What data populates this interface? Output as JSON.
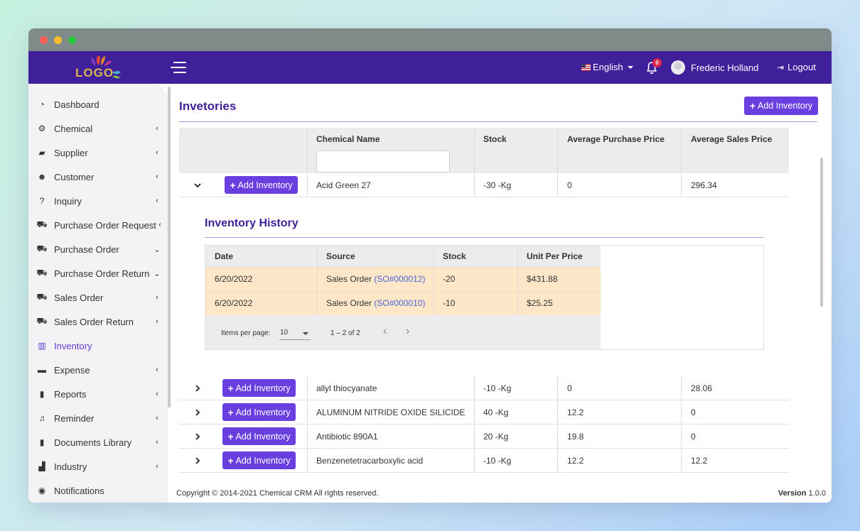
{
  "navbar": {
    "logo_text": "LOGO",
    "language": "English",
    "notifications_count": "0",
    "user_name": "Frederic Holland",
    "logout_label": "Logout"
  },
  "sidebar": {
    "items": [
      {
        "label": "Dashboard",
        "icon": "dashboard-icon",
        "arrow": ""
      },
      {
        "label": "Chemical",
        "icon": "gear-icon",
        "arrow": "‹"
      },
      {
        "label": "Supplier",
        "icon": "truck-icon",
        "arrow": "‹"
      },
      {
        "label": "Customer",
        "icon": "users-icon",
        "arrow": "‹"
      },
      {
        "label": "Inquiry",
        "icon": "question-icon",
        "arrow": "‹"
      },
      {
        "label": "Purchase Order Request",
        "icon": "cart-icon",
        "arrow": "‹"
      },
      {
        "label": "Purchase Order",
        "icon": "cart-icon",
        "arrow": "⌄"
      },
      {
        "label": "Purchase Order Return",
        "icon": "cart-icon",
        "arrow": "⌄"
      },
      {
        "label": "Sales Order",
        "icon": "cart-icon",
        "arrow": "‹"
      },
      {
        "label": "Sales Order Return",
        "icon": "cart-icon",
        "arrow": "‹"
      },
      {
        "label": "Inventory",
        "icon": "inventory-icon",
        "arrow": ""
      },
      {
        "label": "Expense",
        "icon": "wallet-icon",
        "arrow": "‹"
      },
      {
        "label": "Reports",
        "icon": "bar-chart-icon",
        "arrow": "‹"
      },
      {
        "label": "Reminder",
        "icon": "bell-icon",
        "arrow": "‹"
      },
      {
        "label": "Documents Library",
        "icon": "file-icon",
        "arrow": "‹"
      },
      {
        "label": "Industry",
        "icon": "industry-icon",
        "arrow": "‹"
      },
      {
        "label": "Notifications",
        "icon": "stopwatch-icon",
        "arrow": ""
      }
    ]
  },
  "page": {
    "title": "Invetories",
    "add_button_label": "Add Inventory"
  },
  "table": {
    "columns": [
      "Chemical Name",
      "Stock",
      "Average Purchase Price",
      "Average Sales Price"
    ],
    "filter_value": "",
    "row_button_label": "Add Inventory",
    "rows": [
      {
        "name": "Acid Green 27",
        "stock": "-30 -Kg",
        "avg_purchase": "0",
        "avg_sales": "296.34",
        "expanded": true
      },
      {
        "name": "allyl thiocyanate",
        "stock": "-10 -Kg",
        "avg_purchase": "0",
        "avg_sales": "28.06",
        "expanded": false
      },
      {
        "name": "ALUMINUM NITRIDE OXIDE SILICIDE",
        "stock": "40 -Kg",
        "avg_purchase": "12.2",
        "avg_sales": "0",
        "expanded": false
      },
      {
        "name": "Antibiotic 890A1",
        "stock": "20 -Kg",
        "avg_purchase": "19.8",
        "avg_sales": "0",
        "expanded": false
      },
      {
        "name": "Benzenetetracarboxylic acid",
        "stock": "-10 -Kg",
        "avg_purchase": "12.2",
        "avg_sales": "12.2",
        "expanded": false
      }
    ]
  },
  "history": {
    "title": "Inventory History",
    "columns": [
      "Date",
      "Source",
      "Stock",
      "Unit Per Price"
    ],
    "rows": [
      {
        "date": "6/20/2022",
        "source": "Sales Order",
        "source_link": "(SO#000012)",
        "stock": "-20",
        "unit_price": "$431.88"
      },
      {
        "date": "6/20/2022",
        "source": "Sales Order",
        "source_link": "(SO#000010)",
        "stock": "-10",
        "unit_price": "$25.25"
      }
    ],
    "paginator": {
      "items_per_page_label": "Items per page:",
      "items_per_page_value": "10",
      "range_label": "1 – 2 of 2"
    }
  },
  "footer": {
    "copyright": "Copyright © 2014-2021 Chemical CRM All rights reserved.",
    "version_label": "Version",
    "version_value": "1.0.0"
  },
  "colors": {
    "navbar": "#3f1f9a",
    "accent": "#6a3fe0",
    "highlight_row": "#fde7c8"
  }
}
